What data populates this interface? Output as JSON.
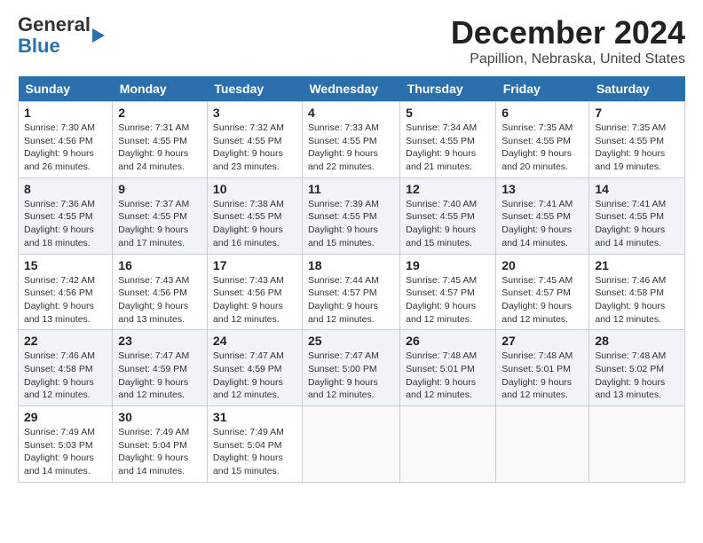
{
  "app": {
    "logo_general": "General",
    "logo_blue": "Blue"
  },
  "header": {
    "month_year": "December 2024",
    "location": "Papillion, Nebraska, United States"
  },
  "days_of_week": [
    "Sunday",
    "Monday",
    "Tuesday",
    "Wednesday",
    "Thursday",
    "Friday",
    "Saturday"
  ],
  "weeks": [
    [
      {
        "day": 1,
        "sunrise": "7:30 AM",
        "sunset": "4:56 PM",
        "daylight": "9 hours and 26 minutes."
      },
      {
        "day": 2,
        "sunrise": "7:31 AM",
        "sunset": "4:55 PM",
        "daylight": "9 hours and 24 minutes."
      },
      {
        "day": 3,
        "sunrise": "7:32 AM",
        "sunset": "4:55 PM",
        "daylight": "9 hours and 23 minutes."
      },
      {
        "day": 4,
        "sunrise": "7:33 AM",
        "sunset": "4:55 PM",
        "daylight": "9 hours and 22 minutes."
      },
      {
        "day": 5,
        "sunrise": "7:34 AM",
        "sunset": "4:55 PM",
        "daylight": "9 hours and 21 minutes."
      },
      {
        "day": 6,
        "sunrise": "7:35 AM",
        "sunset": "4:55 PM",
        "daylight": "9 hours and 20 minutes."
      },
      {
        "day": 7,
        "sunrise": "7:35 AM",
        "sunset": "4:55 PM",
        "daylight": "9 hours and 19 minutes."
      }
    ],
    [
      {
        "day": 8,
        "sunrise": "7:36 AM",
        "sunset": "4:55 PM",
        "daylight": "9 hours and 18 minutes."
      },
      {
        "day": 9,
        "sunrise": "7:37 AM",
        "sunset": "4:55 PM",
        "daylight": "9 hours and 17 minutes."
      },
      {
        "day": 10,
        "sunrise": "7:38 AM",
        "sunset": "4:55 PM",
        "daylight": "9 hours and 16 minutes."
      },
      {
        "day": 11,
        "sunrise": "7:39 AM",
        "sunset": "4:55 PM",
        "daylight": "9 hours and 15 minutes."
      },
      {
        "day": 12,
        "sunrise": "7:40 AM",
        "sunset": "4:55 PM",
        "daylight": "9 hours and 15 minutes."
      },
      {
        "day": 13,
        "sunrise": "7:41 AM",
        "sunset": "4:55 PM",
        "daylight": "9 hours and 14 minutes."
      },
      {
        "day": 14,
        "sunrise": "7:41 AM",
        "sunset": "4:55 PM",
        "daylight": "9 hours and 14 minutes."
      }
    ],
    [
      {
        "day": 15,
        "sunrise": "7:42 AM",
        "sunset": "4:56 PM",
        "daylight": "9 hours and 13 minutes."
      },
      {
        "day": 16,
        "sunrise": "7:43 AM",
        "sunset": "4:56 PM",
        "daylight": "9 hours and 13 minutes."
      },
      {
        "day": 17,
        "sunrise": "7:43 AM",
        "sunset": "4:56 PM",
        "daylight": "9 hours and 12 minutes."
      },
      {
        "day": 18,
        "sunrise": "7:44 AM",
        "sunset": "4:57 PM",
        "daylight": "9 hours and 12 minutes."
      },
      {
        "day": 19,
        "sunrise": "7:45 AM",
        "sunset": "4:57 PM",
        "daylight": "9 hours and 12 minutes."
      },
      {
        "day": 20,
        "sunrise": "7:45 AM",
        "sunset": "4:57 PM",
        "daylight": "9 hours and 12 minutes."
      },
      {
        "day": 21,
        "sunrise": "7:46 AM",
        "sunset": "4:58 PM",
        "daylight": "9 hours and 12 minutes."
      }
    ],
    [
      {
        "day": 22,
        "sunrise": "7:46 AM",
        "sunset": "4:58 PM",
        "daylight": "9 hours and 12 minutes."
      },
      {
        "day": 23,
        "sunrise": "7:47 AM",
        "sunset": "4:59 PM",
        "daylight": "9 hours and 12 minutes."
      },
      {
        "day": 24,
        "sunrise": "7:47 AM",
        "sunset": "4:59 PM",
        "daylight": "9 hours and 12 minutes."
      },
      {
        "day": 25,
        "sunrise": "7:47 AM",
        "sunset": "5:00 PM",
        "daylight": "9 hours and 12 minutes."
      },
      {
        "day": 26,
        "sunrise": "7:48 AM",
        "sunset": "5:01 PM",
        "daylight": "9 hours and 12 minutes."
      },
      {
        "day": 27,
        "sunrise": "7:48 AM",
        "sunset": "5:01 PM",
        "daylight": "9 hours and 12 minutes."
      },
      {
        "day": 28,
        "sunrise": "7:48 AM",
        "sunset": "5:02 PM",
        "daylight": "9 hours and 13 minutes."
      }
    ],
    [
      {
        "day": 29,
        "sunrise": "7:49 AM",
        "sunset": "5:03 PM",
        "daylight": "9 hours and 14 minutes."
      },
      {
        "day": 30,
        "sunrise": "7:49 AM",
        "sunset": "5:04 PM",
        "daylight": "9 hours and 14 minutes."
      },
      {
        "day": 31,
        "sunrise": "7:49 AM",
        "sunset": "5:04 PM",
        "daylight": "9 hours and 15 minutes."
      },
      null,
      null,
      null,
      null
    ]
  ],
  "labels": {
    "sunrise": "Sunrise:",
    "sunset": "Sunset:",
    "daylight": "Daylight:"
  }
}
